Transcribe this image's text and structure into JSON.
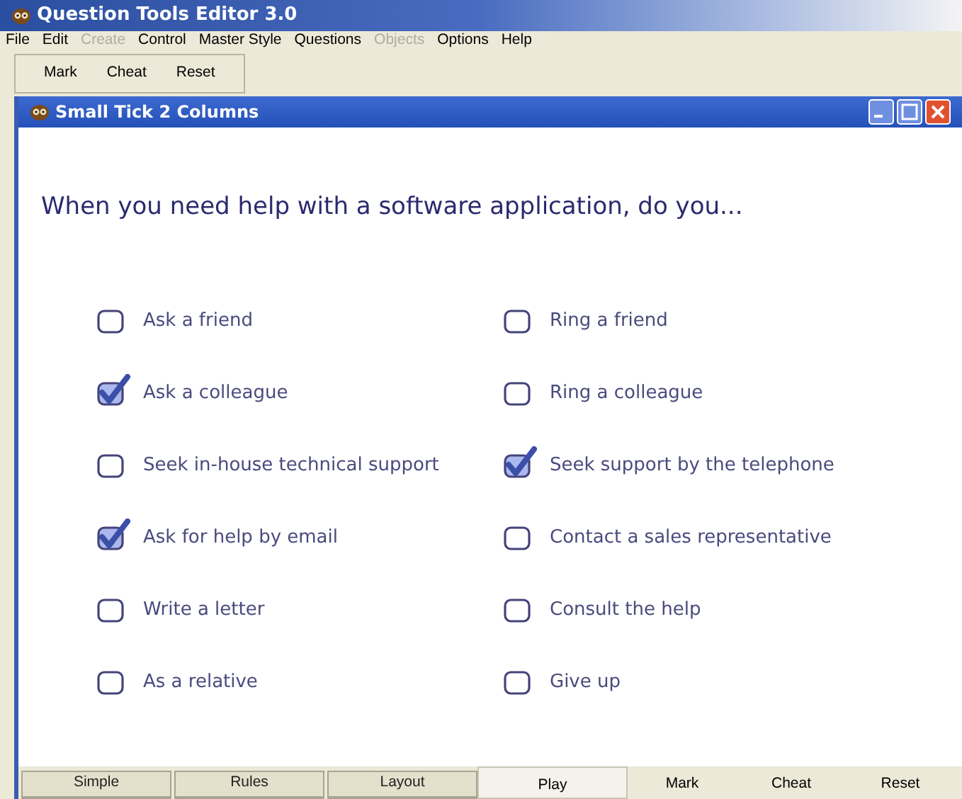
{
  "window": {
    "title": "Question Tools Editor 3.0"
  },
  "menu": [
    {
      "label": "File",
      "disabled": false
    },
    {
      "label": "Edit",
      "disabled": false
    },
    {
      "label": "Create",
      "disabled": true
    },
    {
      "label": "Control",
      "disabled": false
    },
    {
      "label": "Master Style",
      "disabled": false
    },
    {
      "label": "Questions",
      "disabled": false
    },
    {
      "label": "Objects",
      "disabled": true
    },
    {
      "label": "Options",
      "disabled": false
    },
    {
      "label": "Help",
      "disabled": false
    }
  ],
  "toolbar": [
    "Mark",
    "Cheat",
    "Reset"
  ],
  "child_window": {
    "title": "Small Tick 2 Columns"
  },
  "question": "When you need help with a software application, do you...",
  "options": [
    {
      "label": "Ask a friend",
      "checked": false
    },
    {
      "label": "Ring a friend",
      "checked": false
    },
    {
      "label": "Ask a colleague",
      "checked": true
    },
    {
      "label": "Ring a colleague",
      "checked": false
    },
    {
      "label": "Seek in-house technical support",
      "checked": false
    },
    {
      "label": "Seek support by the telephone",
      "checked": true
    },
    {
      "label": "Ask for help by email",
      "checked": true
    },
    {
      "label": "Contact a sales representative",
      "checked": false
    },
    {
      "label": "Write a letter",
      "checked": false
    },
    {
      "label": "Consult the help",
      "checked": false
    },
    {
      "label": "As a relative",
      "checked": false
    },
    {
      "label": "Give up",
      "checked": false
    }
  ],
  "bottom_bar": [
    {
      "label": "Simple",
      "kind": "tab",
      "selected": false
    },
    {
      "label": "Rules",
      "kind": "tab",
      "selected": false
    },
    {
      "label": "Layout",
      "kind": "tab",
      "selected": false
    },
    {
      "label": "Play",
      "kind": "tab",
      "selected": true
    },
    {
      "label": "Mark",
      "kind": "action"
    },
    {
      "label": "Cheat",
      "kind": "action"
    },
    {
      "label": "Reset",
      "kind": "action"
    }
  ]
}
